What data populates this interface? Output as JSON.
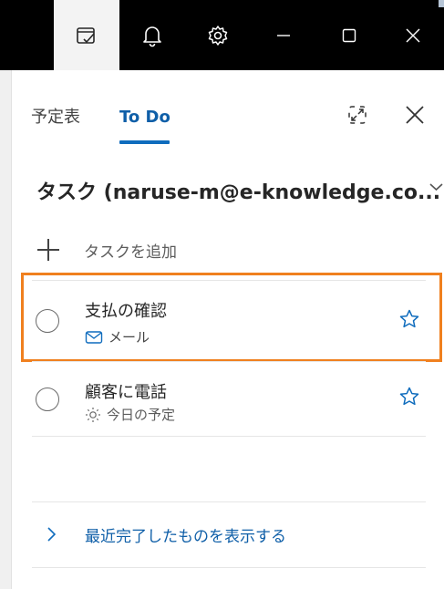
{
  "titlebar": {
    "buttons": [
      {
        "name": "todo-icon"
      },
      {
        "name": "bell-icon"
      },
      {
        "name": "gear-icon"
      },
      {
        "name": "minimize-icon"
      },
      {
        "name": "maximize-icon"
      },
      {
        "name": "close-icon"
      }
    ]
  },
  "tabs": {
    "calendar_label": "予定表",
    "todo_label": "To Do",
    "active": "To Do"
  },
  "header": {
    "title": "タスク (naruse-m@e-knowledge.co..."
  },
  "add_task": {
    "label": "タスクを追加"
  },
  "tasks": [
    {
      "title": "支払の確認",
      "meta_icon": "mail-icon",
      "meta_label": "メール",
      "highlighted": true
    },
    {
      "title": "顧客に電話",
      "meta_icon": "sun-icon",
      "meta_label": "今日の予定",
      "highlighted": false
    }
  ],
  "completed": {
    "label": "最近完了したものを表示する"
  },
  "colors": {
    "accent": "#0f6cbd",
    "highlight_border": "#f0801f",
    "titlebar": "#000000"
  }
}
